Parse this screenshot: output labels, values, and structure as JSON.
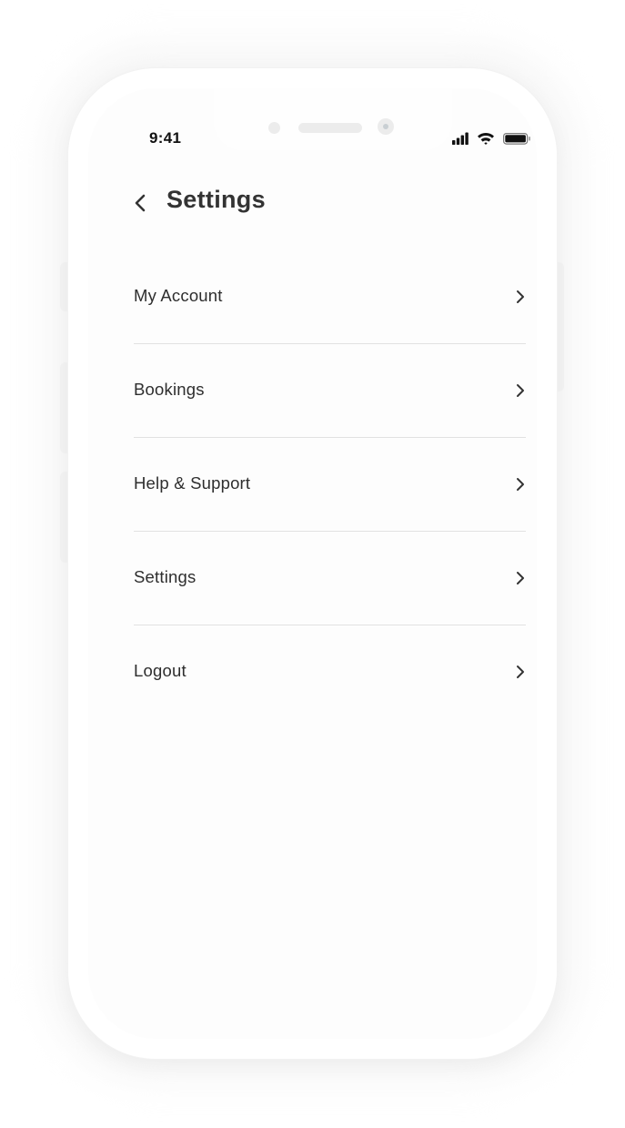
{
  "status_bar": {
    "time": "9:41",
    "icons": [
      "signal-icon",
      "wifi-icon",
      "battery-icon"
    ]
  },
  "header": {
    "back_icon": "chevron-left-icon",
    "title": "Settings"
  },
  "menu": {
    "items": [
      {
        "label": "My Account",
        "icon": "chevron-right-icon"
      },
      {
        "label": "Bookings",
        "icon": "chevron-right-icon"
      },
      {
        "label": "Help & Support",
        "icon": "chevron-right-icon"
      },
      {
        "label": "Settings",
        "icon": "chevron-right-icon"
      },
      {
        "label": "Logout",
        "icon": "chevron-right-icon"
      }
    ]
  },
  "colors": {
    "text_primary": "#333333",
    "divider": "#e2e2e2",
    "background": "#ffffff"
  }
}
